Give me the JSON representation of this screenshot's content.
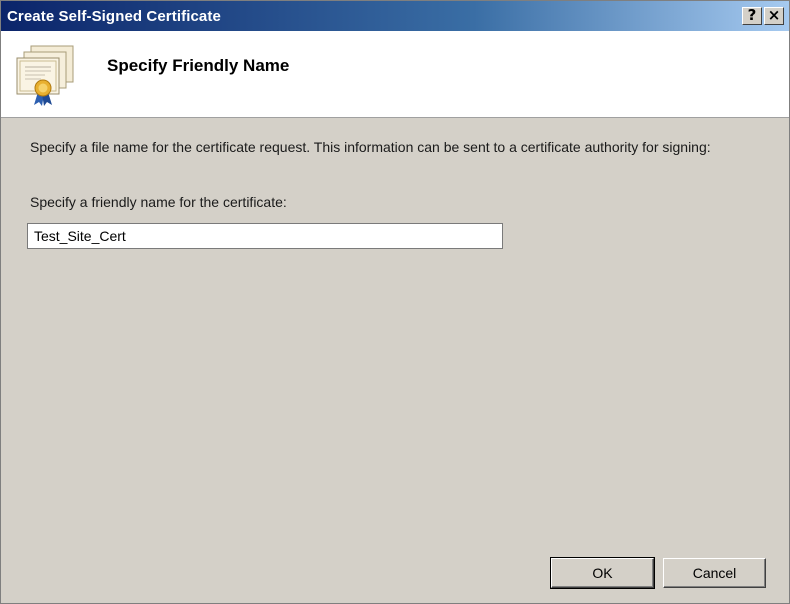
{
  "window": {
    "title": "Create Self-Signed Certificate",
    "help_glyph": "?",
    "close_glyph": "×"
  },
  "header": {
    "title": "Specify Friendly Name",
    "icon": "certificate-icon"
  },
  "body": {
    "description": "Specify a file name for the certificate request.  This information can be sent to a certificate authority for signing:",
    "field_label": "Specify a friendly name for the certificate:",
    "friendly_name_value": "Test_Site_Cert"
  },
  "buttons": {
    "ok_label": "OK",
    "cancel_label": "Cancel"
  },
  "colors": {
    "titlebar_start": "#0b246a",
    "titlebar_end": "#a6caf0",
    "dialog_face": "#d4d0c8",
    "header_bg": "#ffffff"
  }
}
